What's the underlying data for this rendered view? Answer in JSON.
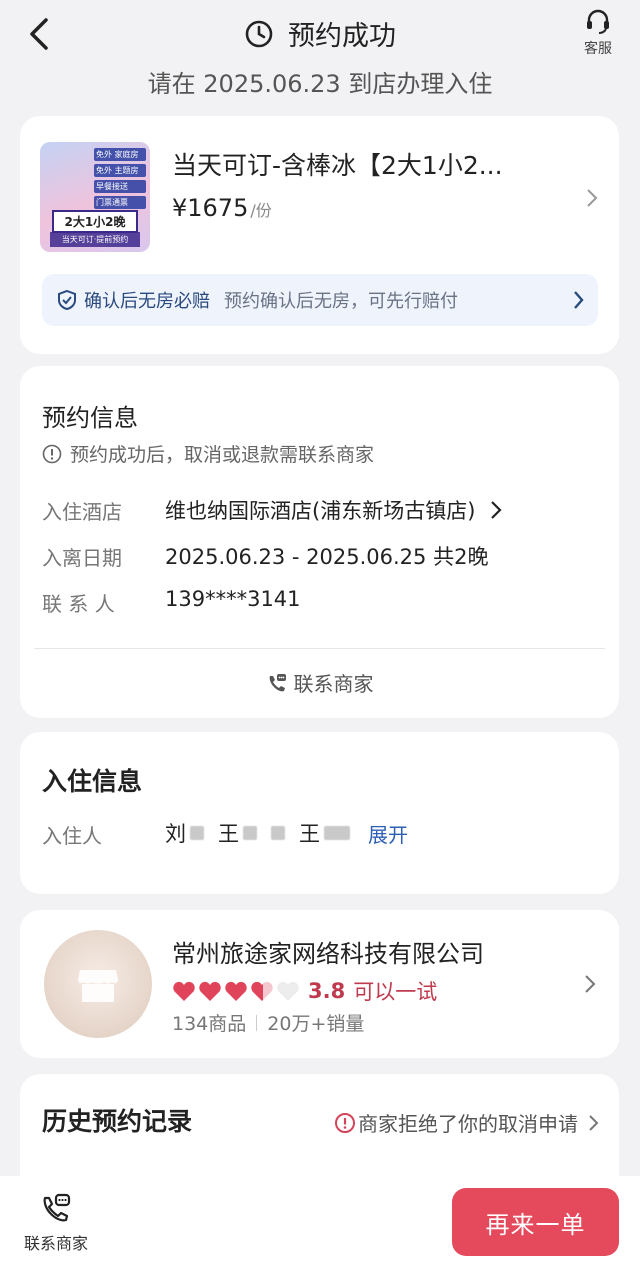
{
  "header": {
    "title": "预约成功",
    "service_label": "客服",
    "subtitle": "请在 2025.06.23 到店办理入住"
  },
  "product": {
    "name": "当天可订-含棒冰【2大1小2...",
    "price": "¥1675",
    "unit": "/份",
    "thumb_tags": [
      "免外 家庭房",
      "免外 主题房",
      "早餐接送",
      "门票通票"
    ],
    "thumb_badge": "2大1小2晚",
    "thumb_badge2": "当天可订·提前预约",
    "guarantee_title": "确认后无房必赔",
    "guarantee_desc": "预约确认后无房，可先行赔付"
  },
  "booking": {
    "title": "预约信息",
    "note": "预约成功后，取消或退款需联系商家",
    "hotel_label": "入住酒店",
    "hotel_value": "维也纳国际酒店(浦东新场古镇店)",
    "dates_label": "入离日期",
    "dates_value": "2025.06.23 - 2025.06.25 共2晚",
    "contact_label": "联 系 人",
    "contact_value": "139****3141",
    "contact_merchant": "联系商家"
  },
  "checkin": {
    "title": "入住信息",
    "guest_label": "入住人",
    "guests": [
      "刘",
      "王",
      "王"
    ],
    "expand": "展开"
  },
  "merchant": {
    "name": "常州旅途家网络科技有限公司",
    "rating": "3.8",
    "rating_text": "可以一试",
    "hearts_filled": 3.5,
    "hearts_total": 5,
    "products": "134商品",
    "sales": "20万+销量"
  },
  "history": {
    "title": "历史预约记录",
    "note": "商家拒绝了你的取消申请"
  },
  "bottom": {
    "contact_label": "联系商家",
    "rebuy_label": "再来一单"
  },
  "colors": {
    "accent": "#e44a5b",
    "link_blue": "#2f5fb3",
    "banner_bg": "#eef3fc",
    "heart_red": "#e0445a"
  }
}
